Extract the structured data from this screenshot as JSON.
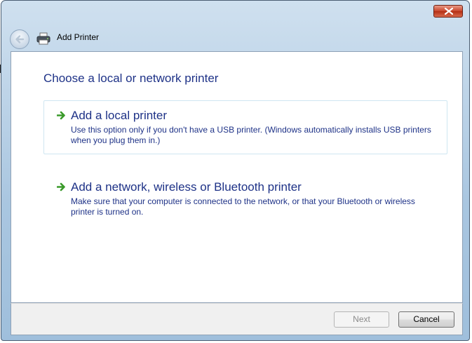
{
  "window": {
    "title": "Add Printer",
    "close_icon": "close-icon",
    "back_icon": "back-arrow-icon",
    "app_icon": "printer-icon"
  },
  "main": {
    "heading": "Choose a local or network printer",
    "options": [
      {
        "title": "Add a local printer",
        "description": "Use this option only if you don't have a USB printer. (Windows automatically installs USB printers when you plug them in.)",
        "icon": "green-arrow-icon"
      },
      {
        "title": "Add a network, wireless or Bluetooth printer",
        "description": "Make sure that your computer is connected to the network, or that your Bluetooth or wireless printer is turned on.",
        "icon": "green-arrow-icon"
      }
    ]
  },
  "footer": {
    "next_label": "Next",
    "next_enabled": false,
    "cancel_label": "Cancel"
  },
  "colors": {
    "link_text": "#1e3287",
    "arrow_green": "#3a9a2a",
    "close_red": "#c7442a"
  }
}
